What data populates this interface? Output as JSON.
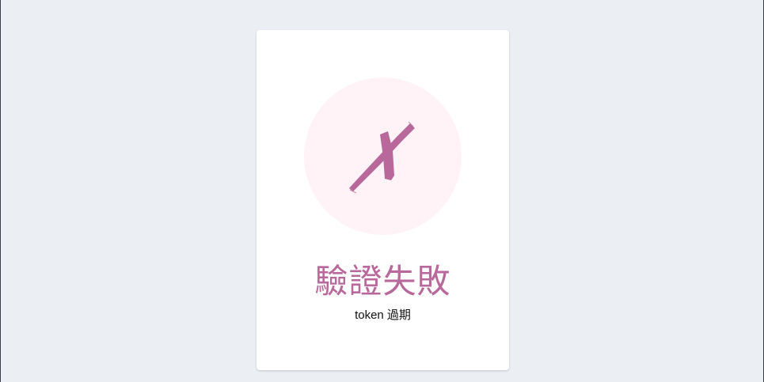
{
  "result": {
    "icon": "x-mark-icon",
    "title": "驗證失敗",
    "message": "token 過期"
  },
  "colors": {
    "page_background": "#ebeff3",
    "card_background": "#ffffff",
    "icon_circle": "#fff3f8",
    "accent": "#b8689b",
    "message_text": "#111111"
  }
}
